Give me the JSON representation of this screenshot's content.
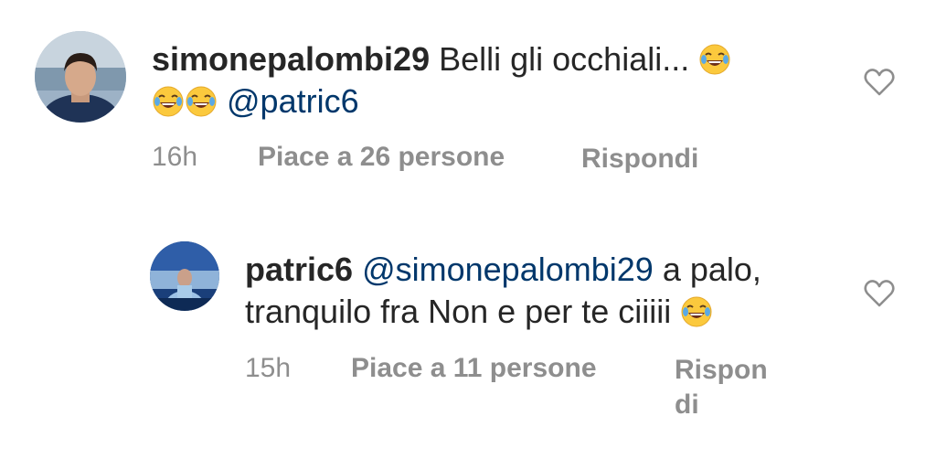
{
  "comments": [
    {
      "username": "simonepalombi29",
      "text_before": "Belli gli occhiali...",
      "emoji_after_text": "face-with-tears-of-joy",
      "emoji_line2": [
        "face-with-tears-of-joy",
        "face-with-tears-of-joy"
      ],
      "mention": "@patric6",
      "time": "16h",
      "likes": "Piace a 26 persone",
      "reply": "Rispondi",
      "like_icon": "heart-outline-icon"
    },
    {
      "username": "patric6",
      "mention": "@simonepalombi29",
      "text_line1_after": "a palo,",
      "text_line2": "tranquilo fra Non e per te ciiiii",
      "emoji_after_text": "face-with-tears-of-joy",
      "time": "15h",
      "likes": "Piace a 11 persone",
      "reply_line1": "Rispon",
      "reply_line2": "di",
      "like_icon": "heart-outline-icon"
    }
  ],
  "colors": {
    "text": "#262626",
    "mention": "#00376b",
    "meta": "#8e8e8e",
    "background": "#ffffff"
  }
}
